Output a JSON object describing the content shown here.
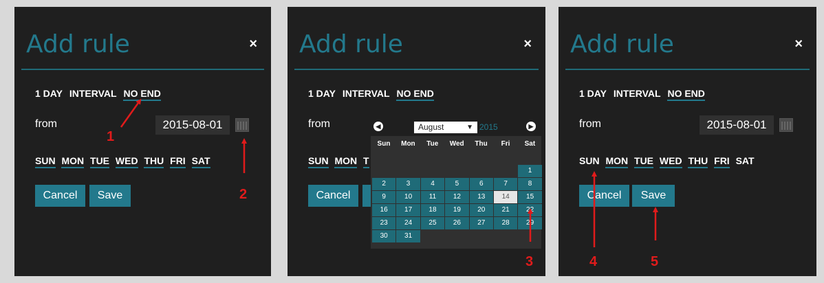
{
  "dialog": {
    "title": "Add rule",
    "close_icon": "×",
    "summary": {
      "count": "1 DAY",
      "interval": "INTERVAL",
      "end": "NO END"
    },
    "from_label": "from",
    "from_value": "2015-08-01",
    "days": [
      "SUN",
      "MON",
      "TUE",
      "WED",
      "THU",
      "FRI",
      "SAT"
    ],
    "cancel_label": "Cancel",
    "save_label": "Save"
  },
  "calendar": {
    "month": "August",
    "year": "2015",
    "prev_icon": "◀",
    "next_icon": "▶",
    "dropdown_icon": "▼",
    "weekdays": [
      "Sun",
      "Mon",
      "Tue",
      "Wed",
      "Thu",
      "Fri",
      "Sat"
    ],
    "weeks": [
      [
        "",
        "",
        "",
        "",
        "",
        "",
        "1"
      ],
      [
        "2",
        "3",
        "4",
        "5",
        "6",
        "7",
        "8"
      ],
      [
        "9",
        "10",
        "11",
        "12",
        "13",
        "14",
        "15"
      ],
      [
        "16",
        "17",
        "18",
        "19",
        "20",
        "21",
        "22"
      ],
      [
        "23",
        "24",
        "25",
        "26",
        "27",
        "28",
        "29"
      ],
      [
        "30",
        "31",
        "",
        "",
        "",
        "",
        ""
      ]
    ],
    "today": "14"
  },
  "markers": [
    "1",
    "2",
    "3",
    "4",
    "5"
  ],
  "colors": {
    "accent": "#23798c",
    "marker": "#e01b1b",
    "panel": "#1f1f1f"
  }
}
